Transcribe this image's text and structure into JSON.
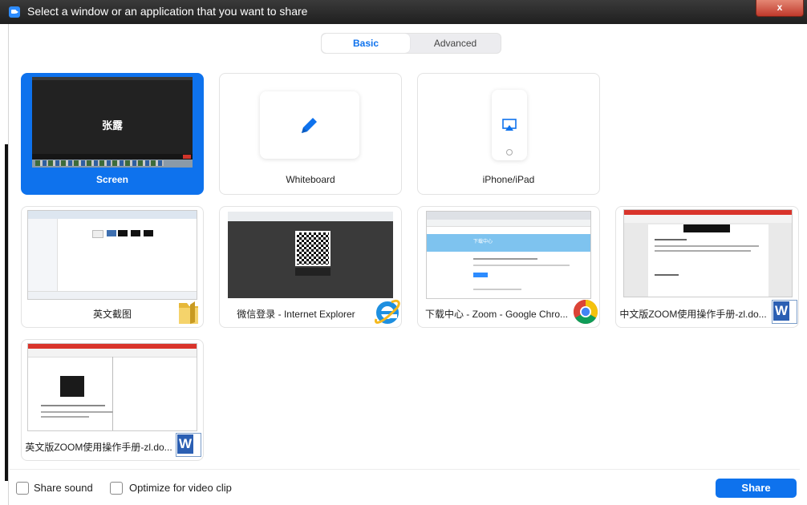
{
  "window": {
    "title": "Select a window or an application that you want to share",
    "close_label": "x"
  },
  "tabs": {
    "basic": "Basic",
    "advanced": "Advanced",
    "active": "Basic"
  },
  "cards": [
    {
      "label": "Screen",
      "selected": true,
      "thumb_text": "张露"
    },
    {
      "label": "Whiteboard",
      "icon": "pencil-icon"
    },
    {
      "label": "iPhone/iPad",
      "icon": "airplay-icon"
    },
    {
      "label": "英文截图",
      "app_icon": "folder-icon"
    },
    {
      "label": "微信登录 - Internet Explorer",
      "app_icon": "internet-explorer-icon"
    },
    {
      "label": "下载中心 - Zoom - Google Chro...",
      "app_icon": "chrome-icon",
      "thumb_text": "下载中心"
    },
    {
      "label": "中文版ZOOM使用操作手册-zl.do...",
      "app_icon": "word-icon"
    },
    {
      "label": "英文版ZOOM使用操作手册-zl.do...",
      "app_icon": "word-icon"
    }
  ],
  "word_icon_letter": "W",
  "footer": {
    "share_sound": "Share sound",
    "optimize": "Optimize for video clip",
    "share_button": "Share"
  },
  "colors": {
    "accent": "#0e72ed",
    "title_bar": "#2b2b2b"
  }
}
